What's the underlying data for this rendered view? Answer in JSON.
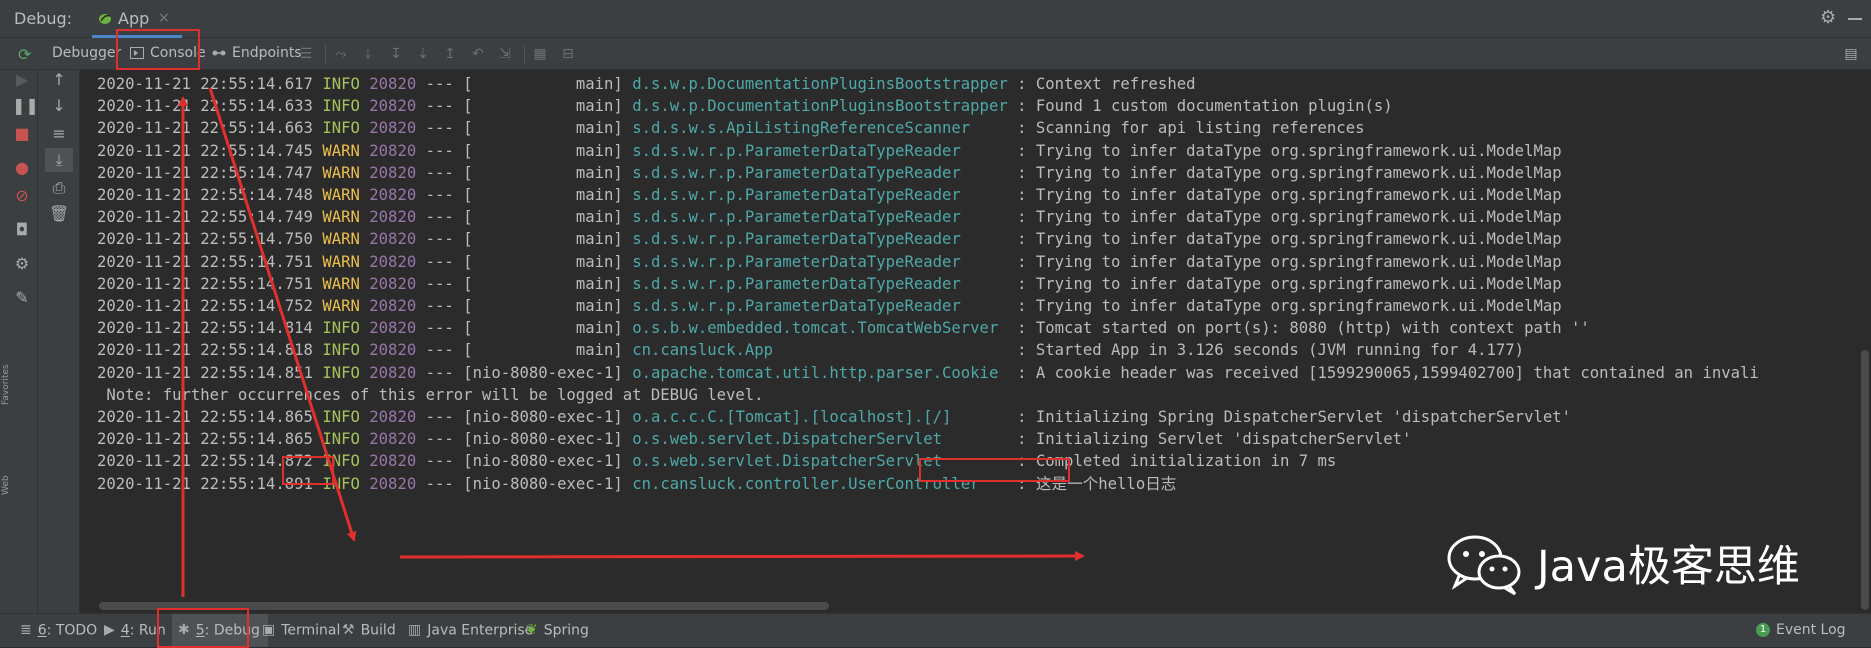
{
  "title_bar": {
    "label": "Debug:",
    "tab_label": "App",
    "tab_close": "×"
  },
  "toolbar": {
    "tabs": [
      {
        "label": "Debugger"
      },
      {
        "label": "Console"
      },
      {
        "label": "Endpoints"
      }
    ]
  },
  "console": {
    "lines": [
      {
        "ts": "2020-11-21 22:55:14.617",
        "level": "INFO",
        "pid": "20820",
        "sep": "---",
        "thread": "[           main]",
        "logger": "d.s.w.p.DocumentationPluginsBootstrapper",
        "msg": ": Context refreshed"
      },
      {
        "ts": "2020-11-21 22:55:14.633",
        "level": "INFO",
        "pid": "20820",
        "sep": "---",
        "thread": "[           main]",
        "logger": "d.s.w.p.DocumentationPluginsBootstrapper",
        "msg": ": Found 1 custom documentation plugin(s)"
      },
      {
        "ts": "2020-11-21 22:55:14.663",
        "level": "INFO",
        "pid": "20820",
        "sep": "---",
        "thread": "[           main]",
        "logger": "s.d.s.w.s.ApiListingReferenceScanner    ",
        "msg": ": Scanning for api listing references"
      },
      {
        "ts": "2020-11-21 22:55:14.745",
        "level": "WARN",
        "pid": "20820",
        "sep": "---",
        "thread": "[           main]",
        "logger": "s.d.s.w.r.p.ParameterDataTypeReader     ",
        "msg": ": Trying to infer dataType org.springframework.ui.ModelMap"
      },
      {
        "ts": "2020-11-21 22:55:14.747",
        "level": "WARN",
        "pid": "20820",
        "sep": "---",
        "thread": "[           main]",
        "logger": "s.d.s.w.r.p.ParameterDataTypeReader     ",
        "msg": ": Trying to infer dataType org.springframework.ui.ModelMap"
      },
      {
        "ts": "2020-11-21 22:55:14.748",
        "level": "WARN",
        "pid": "20820",
        "sep": "---",
        "thread": "[           main]",
        "logger": "s.d.s.w.r.p.ParameterDataTypeReader     ",
        "msg": ": Trying to infer dataType org.springframework.ui.ModelMap"
      },
      {
        "ts": "2020-11-21 22:55:14.749",
        "level": "WARN",
        "pid": "20820",
        "sep": "---",
        "thread": "[           main]",
        "logger": "s.d.s.w.r.p.ParameterDataTypeReader     ",
        "msg": ": Trying to infer dataType org.springframework.ui.ModelMap"
      },
      {
        "ts": "2020-11-21 22:55:14.750",
        "level": "WARN",
        "pid": "20820",
        "sep": "---",
        "thread": "[           main]",
        "logger": "s.d.s.w.r.p.ParameterDataTypeReader     ",
        "msg": ": Trying to infer dataType org.springframework.ui.ModelMap"
      },
      {
        "ts": "2020-11-21 22:55:14.751",
        "level": "WARN",
        "pid": "20820",
        "sep": "---",
        "thread": "[           main]",
        "logger": "s.d.s.w.r.p.ParameterDataTypeReader     ",
        "msg": ": Trying to infer dataType org.springframework.ui.ModelMap"
      },
      {
        "ts": "2020-11-21 22:55:14.751",
        "level": "WARN",
        "pid": "20820",
        "sep": "---",
        "thread": "[           main]",
        "logger": "s.d.s.w.r.p.ParameterDataTypeReader     ",
        "msg": ": Trying to infer dataType org.springframework.ui.ModelMap"
      },
      {
        "ts": "2020-11-21 22:55:14.752",
        "level": "WARN",
        "pid": "20820",
        "sep": "---",
        "thread": "[           main]",
        "logger": "s.d.s.w.r.p.ParameterDataTypeReader     ",
        "msg": ": Trying to infer dataType org.springframework.ui.ModelMap"
      },
      {
        "ts": "2020-11-21 22:55:14.814",
        "level": "INFO",
        "pid": "20820",
        "sep": "---",
        "thread": "[           main]",
        "logger": "o.s.b.w.embedded.tomcat.TomcatWebServer ",
        "msg": ": Tomcat started on port(s): 8080 (http) with context path ''"
      },
      {
        "ts": "2020-11-21 22:55:14.818",
        "level": "INFO",
        "pid": "20820",
        "sep": "---",
        "thread": "[           main]",
        "logger": "cn.cansluck.App                         ",
        "msg": ": Started App in 3.126 seconds (JVM running for 4.177)"
      },
      {
        "ts": "2020-11-21 22:55:14.851",
        "level": "INFO",
        "pid": "20820",
        "sep": "---",
        "thread": "[nio-8080-exec-1]",
        "logger": "o.apache.tomcat.util.http.parser.Cookie ",
        "msg": ": A cookie header was received [1599290065,1599402700] that contained an invali"
      },
      {
        "plain": " Note: further occurrences of this error will be logged at DEBUG level."
      },
      {
        "ts": "2020-11-21 22:55:14.865",
        "level": "INFO",
        "pid": "20820",
        "sep": "---",
        "thread": "[nio-8080-exec-1]",
        "logger": "o.a.c.c.C.[Tomcat].[localhost].[/]      ",
        "msg": ": Initializing Spring DispatcherServlet 'dispatcherServlet'"
      },
      {
        "ts": "2020-11-21 22:55:14.865",
        "level": "INFO",
        "pid": "20820",
        "sep": "---",
        "thread": "[nio-8080-exec-1]",
        "logger": "o.s.web.servlet.DispatcherServlet       ",
        "msg": ": Initializing Servlet 'dispatcherServlet'"
      },
      {
        "ts": "2020-11-21 22:55:14.872",
        "level": "INFO",
        "pid": "20820",
        "sep": "---",
        "thread": "[nio-8080-exec-1]",
        "logger": "o.s.web.servlet.DispatcherServlet       ",
        "msg": ": Completed initialization in 7 ms"
      },
      {
        "ts": "2020-11-21 22:55:14.891",
        "level": "INFO",
        "pid": "20820",
        "sep": "---",
        "thread": "[nio-8080-exec-1]",
        "logger": "cn.cansluck.controller.UserController   ",
        "msg": ": 这是一个hello日志"
      }
    ]
  },
  "watermark": {
    "text": "Java极客思维"
  },
  "bottom_bar": {
    "items": [
      {
        "num": "6",
        "label": ": TODO"
      },
      {
        "num": "4",
        "label": ": Run"
      },
      {
        "num": "5",
        "label": ": Debug"
      },
      {
        "num": "",
        "label": "Terminal"
      },
      {
        "num": "",
        "label": "Build"
      },
      {
        "num": "",
        "label": "Java Enterprise"
      },
      {
        "num": "",
        "label": "Spring"
      }
    ],
    "event_badge": "1",
    "event_log": "Event Log"
  },
  "colors": {
    "info": "#a5c25c",
    "warn": "#ecbe4d",
    "pid": "#9876aa",
    "logger": "#4fa8a8",
    "annotation": "#e0302d",
    "accent": "#4a88c7"
  }
}
